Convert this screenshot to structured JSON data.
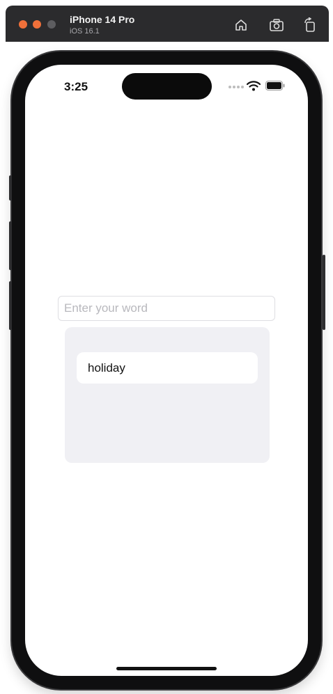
{
  "simulator": {
    "device_name": "iPhone 14 Pro",
    "os_version": "iOS 16.1",
    "toolbar_icons": [
      "home-icon",
      "screenshot-icon",
      "rotate-icon"
    ]
  },
  "status_bar": {
    "time": "3:25",
    "icons": [
      "cellular-signal-icon",
      "wifi-icon",
      "battery-icon"
    ]
  },
  "word_input": {
    "value": "",
    "placeholder": "Enter your word"
  },
  "word_list": {
    "items": [
      {
        "label": "holiday"
      }
    ]
  },
  "colors": {
    "window_chrome": "#2b2b2d",
    "traffic_light_active": "#f0703a",
    "list_background": "#f0f0f4",
    "screen_background": "#ffffff"
  }
}
